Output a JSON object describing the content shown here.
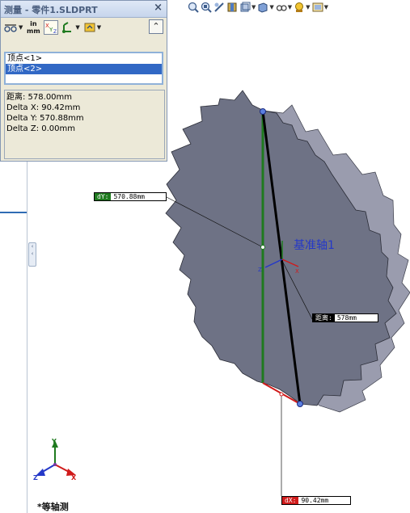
{
  "measure": {
    "title": "测量 - 零件1.SLDPRT",
    "close": "×",
    "unit_top": "in",
    "unit_bottom": "mm",
    "expand": "⌃",
    "selections": [
      "顶点<1>",
      "顶点<2>"
    ],
    "results": {
      "distance": "距离: 578.00mm",
      "delta_x": "Delta X: 90.42mm",
      "delta_y": "Delta Y: 570.88mm",
      "delta_z": "Delta Z: 0.00mm"
    }
  },
  "callouts": {
    "dy": {
      "label": "dY:",
      "value": "570.88mm",
      "color": "#1f7a1f"
    },
    "distance": {
      "label": "距离:",
      "value": "578mm",
      "color": "#000000"
    },
    "dx": {
      "label": "dX:",
      "value": "90.42mm",
      "color": "#d01b1b"
    }
  },
  "scene": {
    "axis_name": "基准轴1",
    "view_name": "*等轴测",
    "triad": {
      "x": "X",
      "y": "Y",
      "z": "Z"
    }
  },
  "colors": {
    "gear_face": "#6b6f82",
    "gear_side": "#9699ab",
    "accent_green": "#1f7a1f",
    "accent_red": "#d01b1b",
    "selection_blue": "#3168c5"
  },
  "toolbar_icons": [
    "zoom-to-fit-icon",
    "zoom-area-icon",
    "previous-view-icon",
    "section-view-icon",
    "view-orientation-icon",
    "display-style-icon",
    "hide-show-icon",
    "edit-appearance-icon",
    "apply-scene-icon",
    "view-settings-icon"
  ],
  "dialog_icons": [
    "measure-mode-icon",
    "units-icon",
    "xyz-relative-icon",
    "projection-icon",
    "history-icon"
  ]
}
